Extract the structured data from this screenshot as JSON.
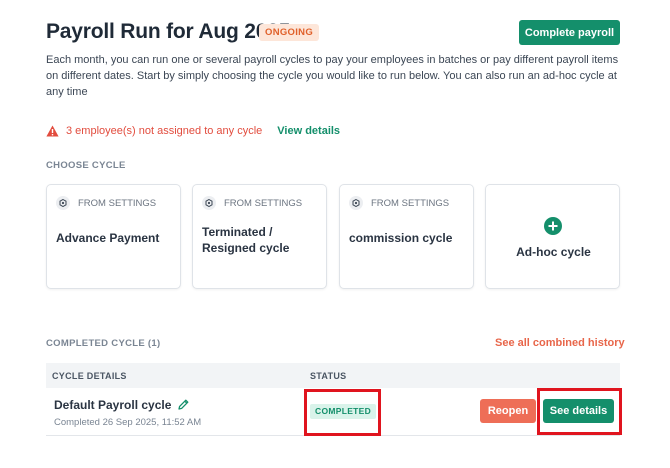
{
  "header": {
    "title": "Payroll Run for Aug 2025",
    "status": "ONGOING",
    "complete_button": "Complete payroll"
  },
  "description": "Each month, you can run one or several payroll cycles to pay your employees in batches or pay different payroll items on different dates. Start by simply choosing the cycle you would like to run below. You can also run an ad-hoc cycle at any time",
  "warning": {
    "text": "3 employee(s) not assigned to any cycle",
    "link": "View details"
  },
  "choose_cycle": {
    "label": "CHOOSE CYCLE",
    "cards": [
      {
        "tag": "FROM SETTINGS",
        "name": "Advance Payment"
      },
      {
        "tag": "FROM SETTINGS",
        "name": "Terminated / Resigned cycle"
      },
      {
        "tag": "FROM SETTINGS",
        "name": "commission cycle"
      }
    ],
    "adhoc": "Ad-hoc cycle"
  },
  "completed": {
    "label": "COMPLETED CYCLE (1)",
    "history_link": "See all combined history",
    "columns": [
      "CYCLE DETAILS",
      "STATUS"
    ],
    "rows": [
      {
        "name": "Default Payroll cycle",
        "date": "Completed 26 Sep 2025, 11:52 AM",
        "status": "COMPLETED",
        "reopen": "Reopen",
        "details": "See details"
      }
    ]
  },
  "colors": {
    "primary": "#148f6b",
    "warning": "#e24c3e",
    "reopen": "#ee6e57",
    "highlight": "#e0141e"
  },
  "icons": [
    "warning-icon",
    "settings-icon",
    "plus-circle-icon",
    "edit-pencil-icon"
  ]
}
